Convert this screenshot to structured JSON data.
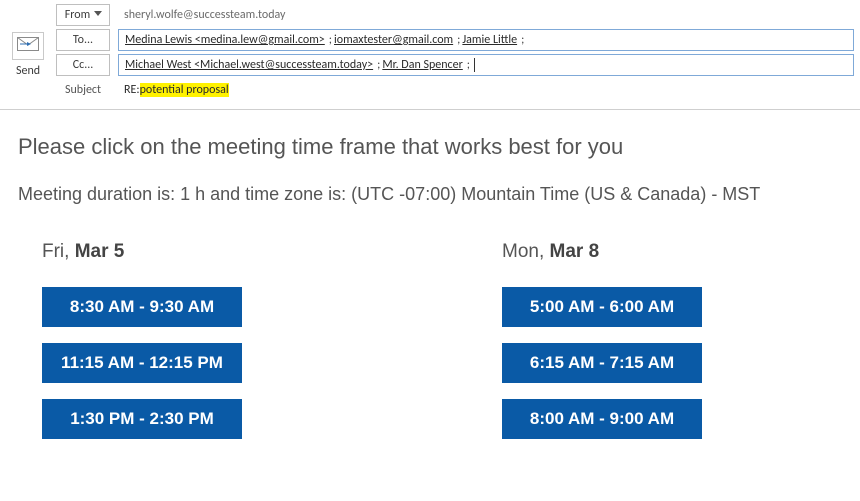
{
  "header": {
    "send_label": "Send",
    "from_label": "From",
    "from_value": "sheryl.wolfe@successteam.today",
    "to_label": "To...",
    "to_recipients": [
      "Medina Lewis <medina.lew@gmail.com>",
      "iomaxtester@gmail.com",
      "Jamie Little"
    ],
    "cc_label": "Cc...",
    "cc_recipients": [
      "Michael West <Michael.west@successteam.today>",
      "Mr. Dan Spencer"
    ],
    "subject_label": "Subject",
    "subject_prefix": "RE: ",
    "subject_highlight": "potential proposal"
  },
  "body": {
    "line1": "Please click on the meeting time frame that works best for you",
    "line2": "Meeting duration is: 1 h and time zone is: (UTC -07:00) Mountain Time (US & Canada) - MST",
    "days": [
      {
        "weekday": "Fri, ",
        "date": "Mar 5",
        "slots": [
          "8:30 AM - 9:30 AM",
          "11:15 AM - 12:15 PM",
          "1:30 PM - 2:30 PM"
        ]
      },
      {
        "weekday": "Mon, ",
        "date": "Mar 8",
        "slots": [
          "5:00 AM - 6:00 AM",
          "6:15 AM - 7:15 AM",
          "8:00 AM - 9:00 AM"
        ]
      }
    ]
  }
}
